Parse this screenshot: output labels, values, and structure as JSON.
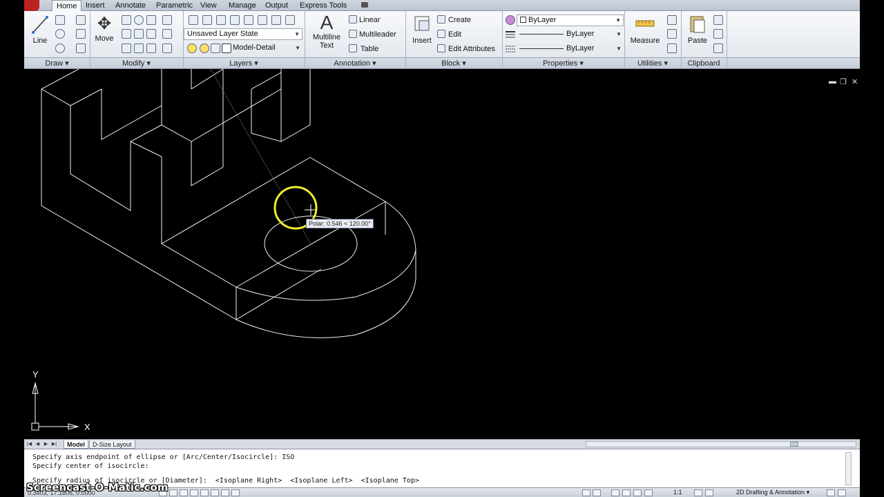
{
  "tabs": [
    {
      "label": "Home",
      "active": true
    },
    {
      "label": "Insert"
    },
    {
      "label": "Annotate"
    },
    {
      "label": "Parametric"
    },
    {
      "label": "View"
    },
    {
      "label": "Manage"
    },
    {
      "label": "Output"
    },
    {
      "label": "Express Tools"
    }
  ],
  "ribbon": {
    "draw": {
      "line_label": "Line"
    },
    "modify": {
      "move_label": "Move"
    },
    "layers": {
      "layer_state": "Unsaved Layer State",
      "current_layer": "Model-Detail"
    },
    "annotation": {
      "mtext_label_1": "Multiline",
      "mtext_label_2": "Text",
      "linear_label": "Linear",
      "multileader_label": "Multileader",
      "table_label": "Table"
    },
    "block": {
      "insert_label": "Insert",
      "create_label": "Create",
      "edit_label": "Edit",
      "edit_attr_label": "Edit Attributes"
    },
    "properties": {
      "color": "ByLayer",
      "linetype": "ByLayer",
      "lineweight": "ByLayer"
    },
    "utilities": {
      "measure_label": "Measure"
    },
    "clipboard": {
      "paste_label": "Paste"
    }
  },
  "panels": {
    "draw": "Draw",
    "modify": "Modify",
    "layers": "Layers",
    "annotation": "Annotation",
    "block": "Block",
    "properties": "Properties",
    "utilities": "Utilities",
    "clipboard": "Clipboard"
  },
  "canvas": {
    "tooltip": "Polar: 0.546 < 120.00°",
    "ucs_x": "X",
    "ucs_y": "Y"
  },
  "layout_tabs": [
    {
      "label": "Model",
      "active": true
    },
    {
      "label": "D-Size Layout"
    }
  ],
  "command_history": [
    "Specify axis endpoint of ellipse or [Arc/Center/Isocircle]: ISO",
    "Specify center of isocircle:",
    "Specify radius of isocircle or [Diameter]:  <Isoplane Right>  <Isoplane Left>  <Isoplane Top>"
  ],
  "status": {
    "coords": "0.3403, 17.1806, 0.0000",
    "scale": "1:1",
    "workspace": "2D Drafting & Annotation"
  },
  "watermark": "Screencast-O-Matic.com",
  "colors": {
    "canvas_bg": "#000000",
    "line": "#ffffff",
    "cursor_circle": "#f2f02a",
    "ribbon_bg": "#eef1f5"
  }
}
